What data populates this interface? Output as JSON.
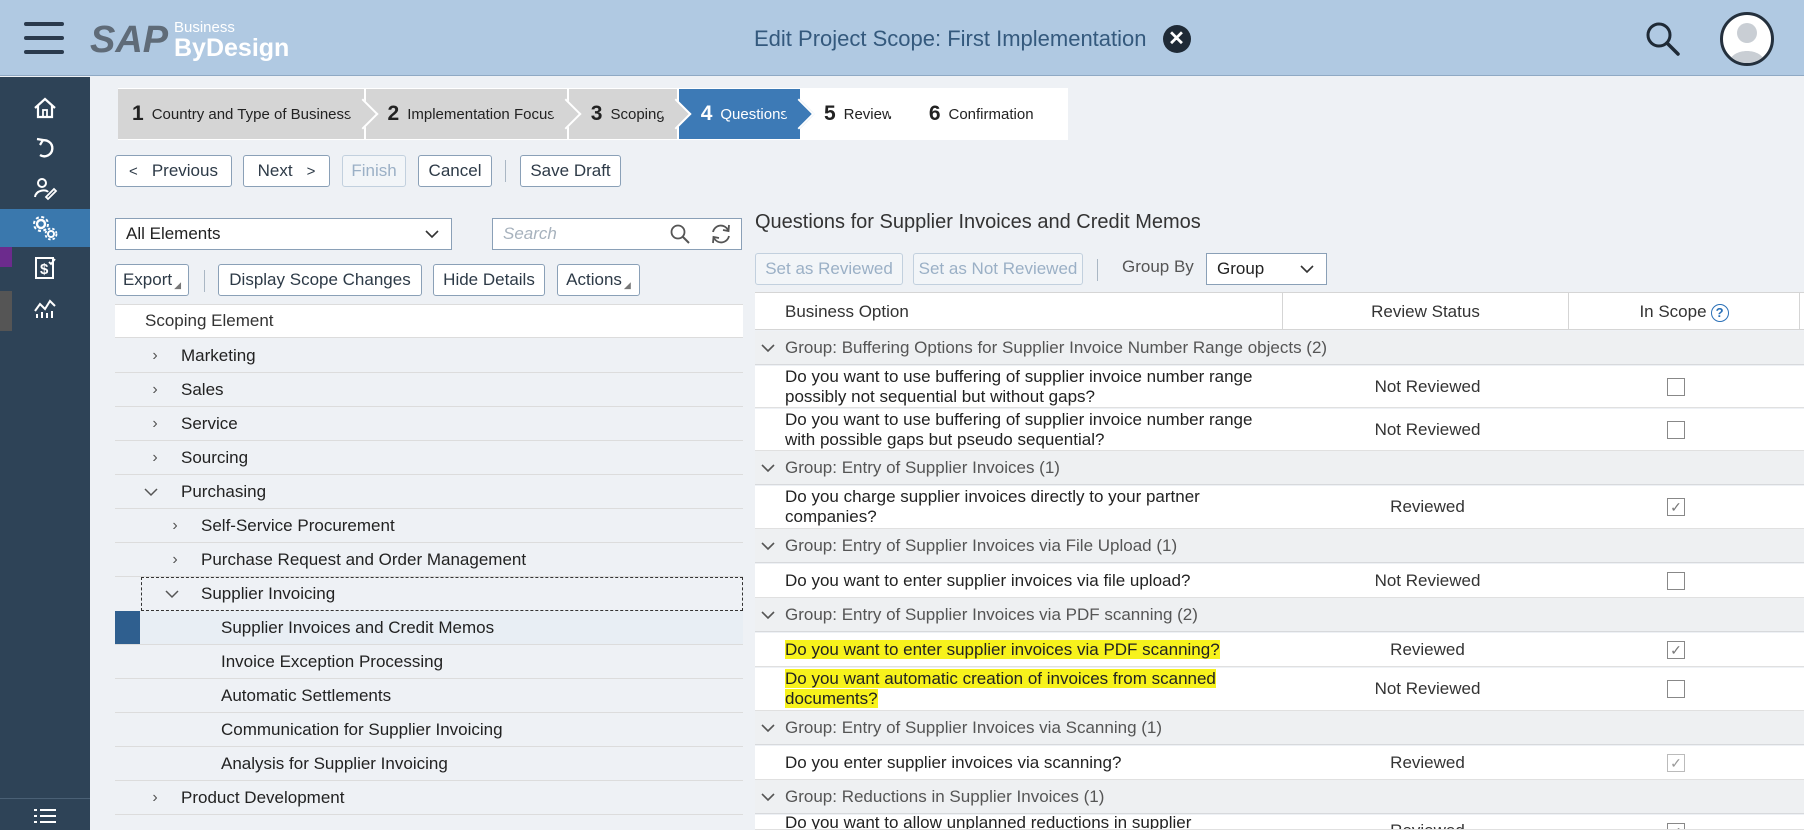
{
  "header": {
    "title": "Edit Project Scope: First Implementation",
    "logo_sap": "SAP",
    "logo_business": "Business",
    "logo_bydesign": "ByDesign"
  },
  "steps": [
    {
      "num": "1",
      "label": "Country and Type of Business",
      "state": "done"
    },
    {
      "num": "2",
      "label": "Implementation Focus",
      "state": "done"
    },
    {
      "num": "3",
      "label": "Scoping",
      "state": "done"
    },
    {
      "num": "4",
      "label": "Questions",
      "state": "active"
    },
    {
      "num": "5",
      "label": "Review",
      "state": "future"
    },
    {
      "num": "6",
      "label": "Confirmation",
      "state": "future"
    }
  ],
  "toolbar": {
    "previous": "Previous",
    "next": "Next",
    "finish": "Finish",
    "cancel": "Cancel",
    "save_draft": "Save Draft"
  },
  "left": {
    "filter_value": "All Elements",
    "search_placeholder": "Search",
    "export": "Export",
    "display_scope_changes": "Display Scope Changes",
    "hide_details": "Hide Details",
    "actions": "Actions",
    "column_header": "Scoping Element",
    "tree": [
      {
        "label": "Marketing",
        "level": 1,
        "expanded": false
      },
      {
        "label": "Sales",
        "level": 1,
        "expanded": false
      },
      {
        "label": "Service",
        "level": 1,
        "expanded": false
      },
      {
        "label": "Sourcing",
        "level": 1,
        "expanded": false
      },
      {
        "label": "Purchasing",
        "level": 1,
        "expanded": true
      },
      {
        "label": "Self-Service Procurement",
        "level": 2,
        "expanded": false
      },
      {
        "label": "Purchase Request and Order Management",
        "level": 2,
        "expanded": false
      },
      {
        "label": "Supplier Invoicing",
        "level": 2,
        "expanded": true
      },
      {
        "label": "Supplier Invoices and Credit Memos",
        "level": 3
      },
      {
        "label": "Invoice Exception Processing",
        "level": 3
      },
      {
        "label": "Automatic Settlements",
        "level": 3
      },
      {
        "label": "Communication for Supplier Invoicing",
        "level": 3
      },
      {
        "label": "Analysis for Supplier Invoicing",
        "level": 3
      },
      {
        "label": "Product Development",
        "level": 1,
        "expanded": false
      }
    ]
  },
  "right": {
    "title": "Questions for Supplier Invoices and Credit Memos",
    "set_reviewed": "Set as Reviewed",
    "set_not_reviewed": "Set as Not Reviewed",
    "group_by_label": "Group By",
    "group_by_value": "Group",
    "columns": {
      "business_option": "Business Option",
      "review_status": "Review Status",
      "in_scope": "In Scope"
    },
    "groups": [
      {
        "label": "Group: Buffering Options for Supplier Invoice Number Range objects (2)"
      },
      {
        "label": "Group: Entry of Supplier Invoices (1)"
      },
      {
        "label": "Group: Entry of Supplier Invoices via File Upload (1)"
      },
      {
        "label": "Group: Entry of Supplier Invoices via PDF scanning (2)"
      },
      {
        "label": "Group: Entry of Supplier Invoices via Scanning (1)"
      },
      {
        "label": "Group: Reductions in Supplier Invoices (1)"
      }
    ],
    "questions": [
      {
        "line1": "Do you want to use buffering of supplier invoice number range",
        "line2": "possibly not sequential but without gaps?",
        "status": "Not Reviewed",
        "in_scope": false
      },
      {
        "line1": "Do you want to use buffering of supplier invoice number range",
        "line2": "with possible gaps but pseudo sequential?",
        "status": "Not Reviewed",
        "in_scope": false
      },
      {
        "line1": "Do you charge supplier invoices directly to your partner",
        "line2": "companies?",
        "status": "Reviewed",
        "in_scope": true
      },
      {
        "line1": "Do you want to enter supplier invoices via file upload?",
        "line2": "",
        "status": "Not Reviewed",
        "in_scope": false
      },
      {
        "line1": "Do you want to enter supplier invoices via PDF scanning?",
        "line2": "",
        "status": "Reviewed",
        "in_scope": true
      },
      {
        "line1": "Do you want automatic creation of invoices from scanned",
        "line2": "documents?",
        "status": "Not Reviewed",
        "in_scope": false
      },
      {
        "line1": "Do you enter supplier invoices via scanning?",
        "line2": "",
        "status": "Reviewed",
        "in_scope": true
      },
      {
        "line1": "Do you want to allow unplanned reductions in supplier",
        "line2": "",
        "status": "Reviewed",
        "in_scope": true
      }
    ]
  }
}
